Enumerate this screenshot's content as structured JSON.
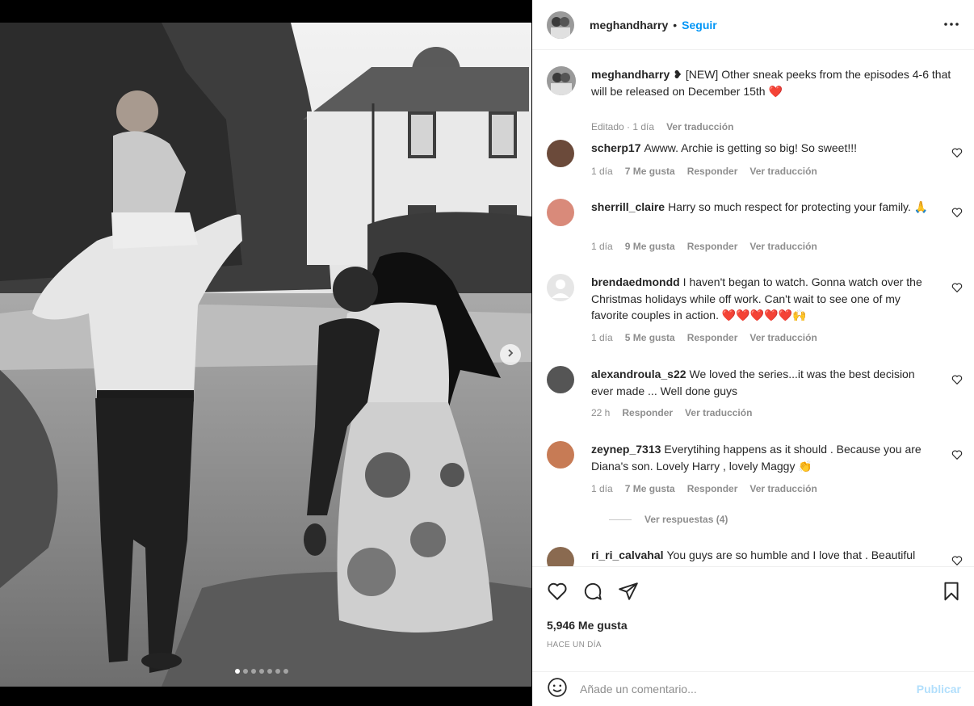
{
  "post": {
    "username": "meghandharry",
    "separator": "•",
    "follow_label": "Seguir",
    "more_icon": "more-horizontal-icon"
  },
  "media": {
    "next_icon": "chevron-right-icon",
    "slide_count": 7,
    "active_slide": 1
  },
  "caption": {
    "username": "meghandharry",
    "text": "❥ [NEW] Other sneak peeks from the episodes 4-6 that will be released on December 15th ❤️",
    "edited": "Editado · 1 día",
    "translate": "Ver traducción"
  },
  "comments": [
    {
      "username": "scherp17",
      "text": "Awww. Archie is getting so big! So sweet!!!",
      "time": "1 día",
      "likes": "7 Me gusta",
      "reply": "Responder",
      "translate": "Ver traducción",
      "avatar_color": "#6b4a3a"
    },
    {
      "username": "sherrill_claire",
      "text": "Harry so much respect for protecting your family. 🙏",
      "time": "1 día",
      "likes": "9 Me gusta",
      "reply": "Responder",
      "translate": "Ver traducción",
      "avatar_color": "#d98a7a"
    },
    {
      "username": "brendaedmondd",
      "text": "I haven't began to watch. Gonna watch over the Christmas holidays while off work. Can't wait to see one of my favorite couples in action. ❤️❤️❤️❤️❤️🙌",
      "time": "1 día",
      "likes": "5 Me gusta",
      "reply": "Responder",
      "translate": "Ver traducción",
      "avatar_color": "#e6e6e6"
    },
    {
      "username": "alexandroula_s22",
      "text": "We loved the series...it was the best decision ever made ... Well done guys",
      "time": "22 h",
      "likes": "",
      "reply": "Responder",
      "translate": "Ver traducción",
      "avatar_color": "#555555"
    },
    {
      "username": "zeynep_7313",
      "text": "Everytihing happens as it should . Because you are Diana's son. Lovely Harry , lovely Maggy 👏",
      "time": "1 día",
      "likes": "7 Me gusta",
      "reply": "Responder",
      "translate": "Ver traducción",
      "avatar_color": "#c77b55",
      "view_replies": "Ver respuestas (4)"
    },
    {
      "username": "ri_ri_calvahal",
      "text": "You guys are so humble and I love that . Beautiful",
      "avatar_color": "#8a6a50"
    }
  ],
  "actions": {
    "like_icon": "heart-icon",
    "comment_icon": "comment-icon",
    "share_icon": "send-icon",
    "save_icon": "bookmark-icon",
    "likes_count": "5,946 Me gusta",
    "posted": "HACE UN DÍA"
  },
  "add_comment": {
    "emoji_icon": "emoji-icon",
    "placeholder": "Añade un comentario...",
    "publish": "Publicar"
  },
  "colors": {
    "link_blue": "#0095f6",
    "publish_disabled": "#b2dffc",
    "muted": "#8e8e8e"
  }
}
